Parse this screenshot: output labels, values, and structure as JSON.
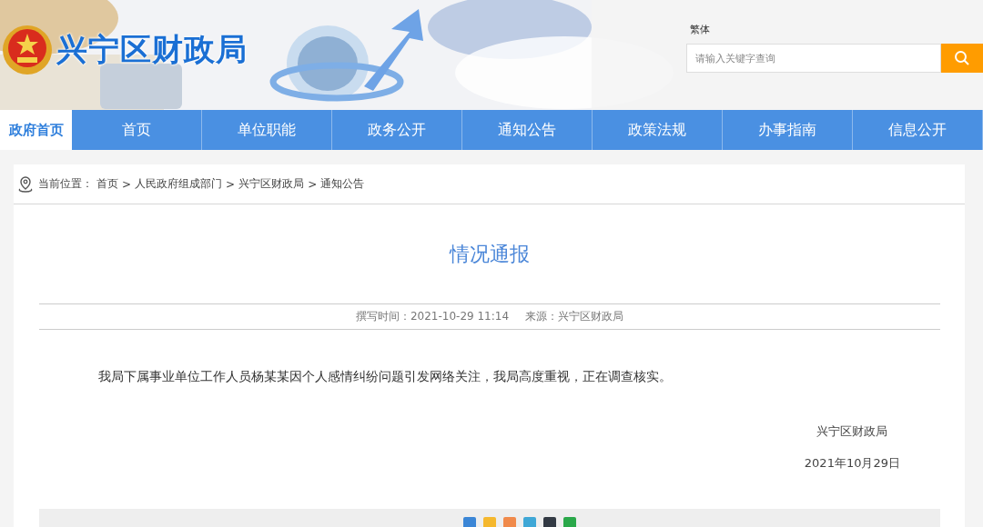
{
  "header": {
    "site_title": "兴宁区财政局",
    "language_link": "繁体",
    "search": {
      "placeholder": "请输入关键字查询"
    }
  },
  "nav": [
    {
      "label": "政府首页",
      "selected": true
    },
    {
      "label": "首页",
      "selected": false
    },
    {
      "label": "单位职能",
      "selected": false
    },
    {
      "label": "政务公开",
      "selected": false
    },
    {
      "label": "通知公告",
      "selected": false
    },
    {
      "label": "政策法规",
      "selected": false
    },
    {
      "label": "办事指南",
      "selected": false
    },
    {
      "label": "信息公开",
      "selected": false
    }
  ],
  "breadcrumb": {
    "label": "当前位置：",
    "items": [
      "首页",
      "人民政府组成部门",
      "兴宁区财政局",
      "通知公告"
    ],
    "separator": ">"
  },
  "article": {
    "title": "情况通报",
    "meta": [
      {
        "label": "撰写时间：",
        "value": "2021-10-29 11:14"
      },
      {
        "label": "来源：",
        "value": "兴宁区财政局"
      }
    ],
    "body": "我局下属事业单位工作人员杨某某因个人感情纠纷问题引发网络关注，我局高度重视，正在调查核实。",
    "signature": "兴宁区财政局",
    "date": "2021年10月29日"
  },
  "share_icons": [
    {
      "color": "#3b86d6"
    },
    {
      "color": "#f5b82e"
    },
    {
      "color": "#f08a4b"
    },
    {
      "color": "#3fa7d6"
    },
    {
      "color": "#333a44"
    },
    {
      "color": "#2aa84a"
    }
  ]
}
